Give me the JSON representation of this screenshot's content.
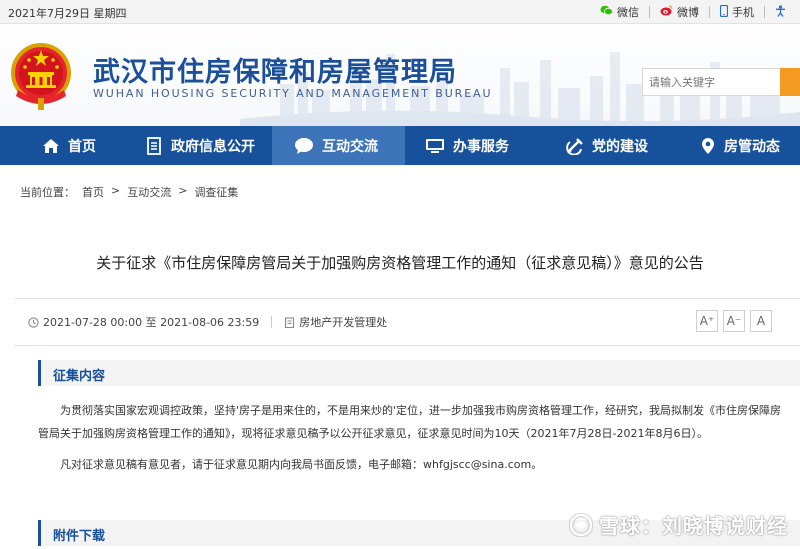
{
  "topbar": {
    "date": "2021年7月29日 星期四",
    "links": [
      {
        "label": "微信",
        "icon": "wechat-icon"
      },
      {
        "label": "微博",
        "icon": "weibo-icon"
      },
      {
        "label": "手机",
        "icon": "mobile-icon"
      },
      {
        "label": "无",
        "icon": "accessibility-icon"
      }
    ]
  },
  "header": {
    "title_cn": "武汉市住房保障和房屋管理局",
    "title_en": "WUHAN HOUSING SECURITY AND MANAGEMENT BUREAU",
    "search_placeholder": "请输入关键字"
  },
  "nav": {
    "items": [
      {
        "label": "首页",
        "icon": "home-icon"
      },
      {
        "label": "政府信息公开",
        "icon": "document-icon"
      },
      {
        "label": "互动交流",
        "icon": "chat-icon",
        "active": true
      },
      {
        "label": "办事服务",
        "icon": "monitor-icon"
      },
      {
        "label": "党的建设",
        "icon": "party-emblem-icon"
      },
      {
        "label": "房管动态",
        "icon": "location-icon"
      }
    ]
  },
  "breadcrumb": {
    "prefix": "当前位置：",
    "items": [
      "首页",
      "互动交流",
      "调查征集"
    ],
    "separator": ">"
  },
  "article": {
    "title": "关于征求《市住房保障房管局关于加强购房资格管理工作的通知（征求意见稿）》意见的公告",
    "date_range": "2021-07-28 00:00 至 2021-08-06 23:59",
    "department": "房地产开发管理处",
    "font_buttons": [
      "A⁺",
      "A⁻",
      "A"
    ],
    "section1_title": "征集内容",
    "para1": "为贯彻落实国家宏观调控政策，坚持'房子是用来住的，不是用来炒的'定位，进一步加强我市购房资格管理工作，经研究，我局拟制发《市住房保障房管局关于加强购房资格管理工作的通知》，现将征求意见稿予以公开征求意见，征求意见时间为10天（2021年7月28日-2021年8月6日）。",
    "para2": "凡对征求意见稿有意见者，请于征求意见期内向我局书面反馈，电子邮箱：whfgjscc@sina.com。",
    "section2_title": "附件下载"
  },
  "watermark": "雪球：刘晓博说财经",
  "colors": {
    "nav_bg": "#17509b",
    "nav_active": "#3c73b9",
    "title_blue": "#1b4f9a",
    "search_button": "#f59a23"
  }
}
